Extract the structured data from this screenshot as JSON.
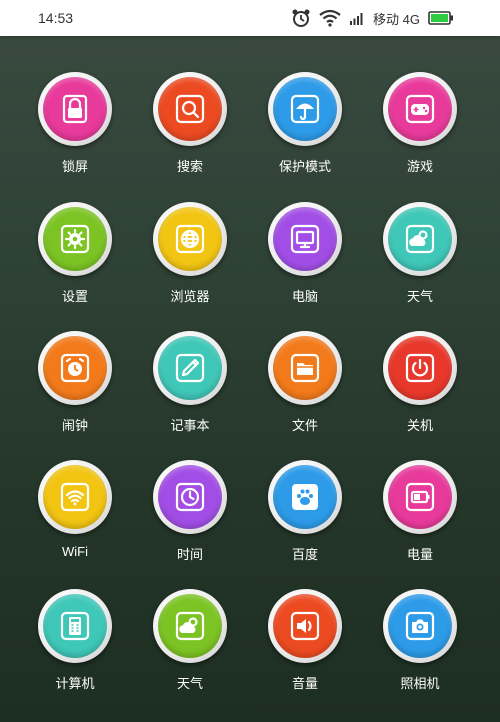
{
  "status_bar": {
    "time": "14:53",
    "carrier": "移动 4G",
    "battery_color": "#2ecc40"
  },
  "apps": [
    {
      "label": "锁屏",
      "icon": "lock-icon",
      "color": "#e83a9b"
    },
    {
      "label": "搜索",
      "icon": "search-icon",
      "color": "#ec4b22"
    },
    {
      "label": "保护模式",
      "icon": "umbrella-icon",
      "color": "#2d9be8"
    },
    {
      "label": "游戏",
      "icon": "gamepad-icon",
      "color": "#e83a9b"
    },
    {
      "label": "设置",
      "icon": "gear-icon",
      "color": "#7cc424"
    },
    {
      "label": "浏览器",
      "icon": "globe-icon",
      "color": "#f2c513"
    },
    {
      "label": "电脑",
      "icon": "monitor-icon",
      "color": "#a24ee6"
    },
    {
      "label": "天气",
      "icon": "weather-icon",
      "color": "#3fc7b8"
    },
    {
      "label": "闹钟",
      "icon": "alarm-clock-icon",
      "color": "#f27a1b"
    },
    {
      "label": "记事本",
      "icon": "notepad-icon",
      "color": "#3fc7b8"
    },
    {
      "label": "文件",
      "icon": "folder-icon",
      "color": "#f27a1b"
    },
    {
      "label": "关机",
      "icon": "power-icon",
      "color": "#e8382b"
    },
    {
      "label": "WiFi",
      "icon": "wifi-icon",
      "color": "#f2c513"
    },
    {
      "label": "时间",
      "icon": "clock-icon",
      "color": "#a24ee6"
    },
    {
      "label": "百度",
      "icon": "paw-icon",
      "color": "#2d9be8"
    },
    {
      "label": "电量",
      "icon": "battery-icon",
      "color": "#e83a9b"
    },
    {
      "label": "计算机",
      "icon": "calculator-icon",
      "color": "#3fc7b8"
    },
    {
      "label": "天气",
      "icon": "weather-icon",
      "color": "#7cc424"
    },
    {
      "label": "音量",
      "icon": "speaker-icon",
      "color": "#ec4b22"
    },
    {
      "label": "照相机",
      "icon": "camera-icon",
      "color": "#2d9be8"
    }
  ]
}
